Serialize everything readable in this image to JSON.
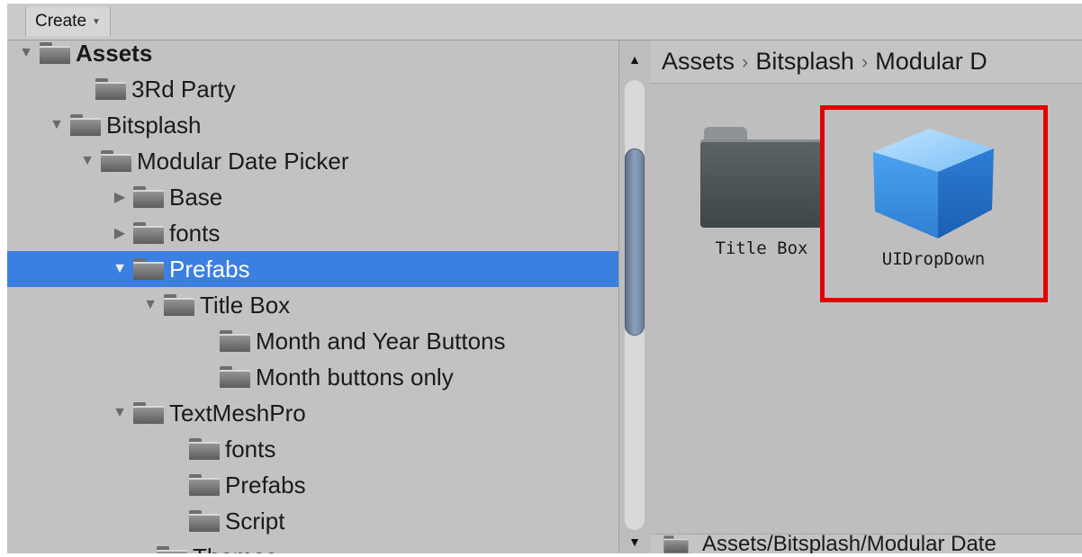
{
  "toolbar": {
    "create_label": "Create"
  },
  "tree": [
    {
      "label": "Assets",
      "arrow": "▼",
      "bold": true,
      "selected": false
    },
    {
      "label": "3Rd Party",
      "arrow": "",
      "bold": false,
      "selected": false
    },
    {
      "label": "Bitsplash",
      "arrow": "▼",
      "bold": false,
      "selected": false
    },
    {
      "label": "Modular Date Picker",
      "arrow": "▼",
      "bold": false,
      "selected": false
    },
    {
      "label": "Base",
      "arrow": "▶",
      "bold": false,
      "selected": false
    },
    {
      "label": "fonts",
      "arrow": "▶",
      "bold": false,
      "selected": false
    },
    {
      "label": "Prefabs",
      "arrow": "▼",
      "bold": false,
      "selected": true
    },
    {
      "label": "Title Box",
      "arrow": "▼",
      "bold": false,
      "selected": false
    },
    {
      "label": "Month and Year Buttons",
      "arrow": "",
      "bold": false,
      "selected": false
    },
    {
      "label": "Month buttons only",
      "arrow": "",
      "bold": false,
      "selected": false
    },
    {
      "label": "TextMeshPro",
      "arrow": "▼",
      "bold": false,
      "selected": false
    },
    {
      "label": "fonts",
      "arrow": "",
      "bold": false,
      "selected": false
    },
    {
      "label": "Prefabs",
      "arrow": "",
      "bold": false,
      "selected": false
    },
    {
      "label": "Script",
      "arrow": "",
      "bold": false,
      "selected": false
    },
    {
      "label": "Themes",
      "arrow": "",
      "bold": false,
      "selected": false
    }
  ],
  "scrollbar": {
    "up_icon": "▲",
    "down_icon": "▼",
    "position": 0.25
  },
  "breadcrumb": [
    "Assets",
    "Bitsplash",
    "Modular D"
  ],
  "breadcrumb_separator": "›",
  "assets": [
    {
      "label": "Title Box",
      "icon": "folder-icon"
    },
    {
      "label": "UIDropDown",
      "icon": "prefab-cube-icon"
    }
  ],
  "bottom_path": "Assets/Bitsplash/Modular Date",
  "colors": {
    "selection": "#3b7fe0",
    "highlight": "#e10000"
  }
}
